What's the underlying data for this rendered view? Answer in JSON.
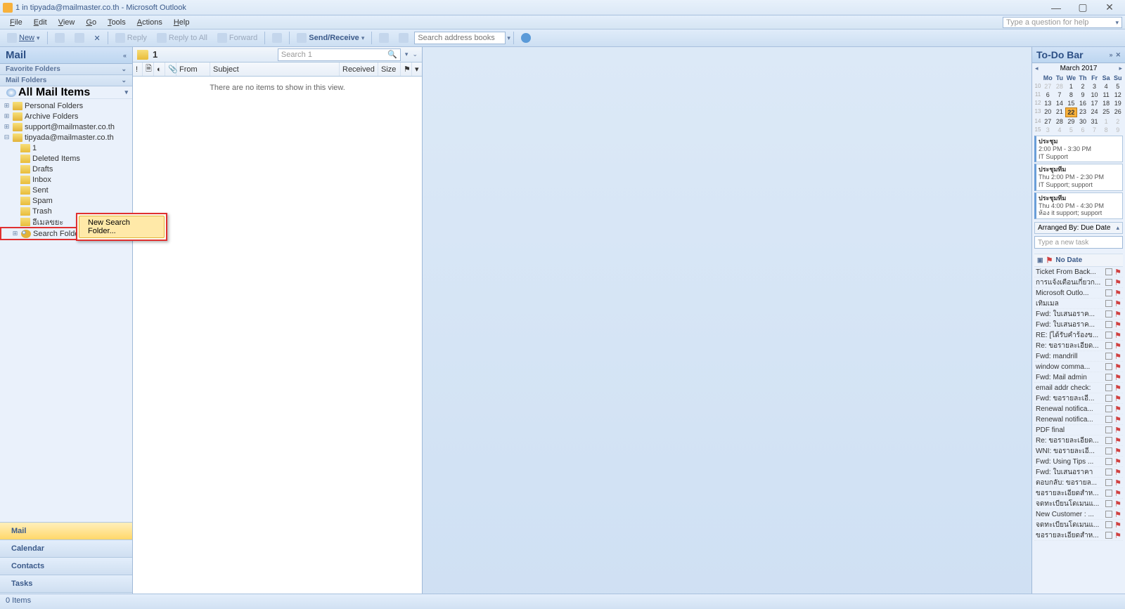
{
  "window": {
    "title": "1 in tipyada@mailmaster.co.th - Microsoft Outlook",
    "help_placeholder": "Type a question for help"
  },
  "menu": [
    "File",
    "Edit",
    "View",
    "Go",
    "Tools",
    "Actions",
    "Help"
  ],
  "toolbar": {
    "new": "New",
    "reply": "Reply",
    "reply_all": "Reply to All",
    "forward": "Forward",
    "send_receive": "Send/Receive",
    "search_books_ph": "Search address books"
  },
  "nav": {
    "header": "Mail",
    "fav": "Favorite Folders",
    "mail_folders": "Mail Folders",
    "all_items": "All Mail Items",
    "roots": [
      {
        "label": "Personal Folders"
      },
      {
        "label": "Archive Folders"
      },
      {
        "label": "support@mailmaster.co.th"
      },
      {
        "label": "tipyada@mailmaster.co.th",
        "children": [
          "1",
          "Deleted Items",
          "Drafts",
          "Inbox",
          "Sent",
          "Spam",
          "Trash",
          "อีเมลขยะ"
        ]
      }
    ],
    "search_folders": "Search Folders",
    "ctx_new_search": "New Search Folder...",
    "buttons": {
      "mail": "Mail",
      "calendar": "Calendar",
      "contacts": "Contacts",
      "tasks": "Tasks"
    }
  },
  "list": {
    "folder_name": "1",
    "search_ph": "Search 1",
    "cols": {
      "from": "From",
      "subject": "Subject",
      "received": "Received",
      "size": "Size"
    },
    "empty": "There are no items to show in this view."
  },
  "todo": {
    "header": "To-Do Bar",
    "month": "March 2017",
    "day_headers": [
      "Mo",
      "Tu",
      "We",
      "Th",
      "Fr",
      "Sa",
      "Su"
    ],
    "weeks": [
      {
        "wk": "10",
        "days": [
          {
            "d": "27",
            "off": true
          },
          {
            "d": "28",
            "off": true
          },
          {
            "d": "1"
          },
          {
            "d": "2"
          },
          {
            "d": "3"
          },
          {
            "d": "4"
          },
          {
            "d": "5"
          }
        ]
      },
      {
        "wk": "11",
        "days": [
          {
            "d": "6"
          },
          {
            "d": "7"
          },
          {
            "d": "8"
          },
          {
            "d": "9"
          },
          {
            "d": "10"
          },
          {
            "d": "11"
          },
          {
            "d": "12"
          }
        ]
      },
      {
        "wk": "12",
        "days": [
          {
            "d": "13"
          },
          {
            "d": "14"
          },
          {
            "d": "15"
          },
          {
            "d": "16"
          },
          {
            "d": "17"
          },
          {
            "d": "18"
          },
          {
            "d": "19"
          }
        ]
      },
      {
        "wk": "13",
        "days": [
          {
            "d": "20"
          },
          {
            "d": "21"
          },
          {
            "d": "22",
            "today": true
          },
          {
            "d": "23"
          },
          {
            "d": "24"
          },
          {
            "d": "25"
          },
          {
            "d": "26"
          }
        ]
      },
      {
        "wk": "14",
        "days": [
          {
            "d": "27"
          },
          {
            "d": "28"
          },
          {
            "d": "29"
          },
          {
            "d": "30"
          },
          {
            "d": "31"
          },
          {
            "d": "1",
            "off": true
          },
          {
            "d": "2",
            "off": true
          }
        ]
      },
      {
        "wk": "15",
        "days": [
          {
            "d": "3",
            "off": true
          },
          {
            "d": "4",
            "off": true
          },
          {
            "d": "5",
            "off": true
          },
          {
            "d": "6",
            "off": true
          },
          {
            "d": "7",
            "off": true
          },
          {
            "d": "8",
            "off": true
          },
          {
            "d": "9",
            "off": true
          }
        ]
      }
    ],
    "appts": [
      {
        "subj": "ประชุม",
        "time": "2:00 PM - 3:30 PM",
        "loc": "IT Support"
      },
      {
        "subj": "ประชุมทีม",
        "time": "Thu 2:00 PM - 2:30 PM",
        "loc": "IT Support; support"
      },
      {
        "subj": "ประชุมทีม",
        "time": "Thu 4:00 PM - 4:30 PM",
        "loc": "ห้อง it support; support"
      }
    ],
    "arranged_by": "Arranged By: Due Date",
    "new_task_ph": "Type a new task",
    "group": "No Date",
    "tasks": [
      "Ticket From Back...",
      "การแจ้งเตือนเกี่ยวก...",
      "Microsoft Outlo...",
      "เทิมเมล",
      "Fwd: ใบเสนอราค...",
      "Fwd: ใบเสนอราค...",
      "RE: [ได้รับคำร้องข...",
      "Re: ขอรายละเอียด...",
      "Fwd: mandrill",
      "window comma...",
      "Fwd: Mail admin",
      "email addr check:",
      "Fwd: ขอรายละเอี...",
      "Renewal notifica...",
      "Renewal notifica...",
      "PDF final",
      "Re: ขอรายละเอียด...",
      "WNI: ขอรายละเอี...",
      "Fwd: Using Tips ...",
      "Fwd: ใบเสนอราคา",
      "ตอบกลับ: ขอรายล...",
      "ขอรายละเอียดสำห...",
      "จดทะเบียนโดเมนแ...",
      "New Customer : ...",
      "จดทะเบียนโดเมนแ...",
      "ขอรายละเอียดสำห..."
    ]
  },
  "status": "0 Items"
}
